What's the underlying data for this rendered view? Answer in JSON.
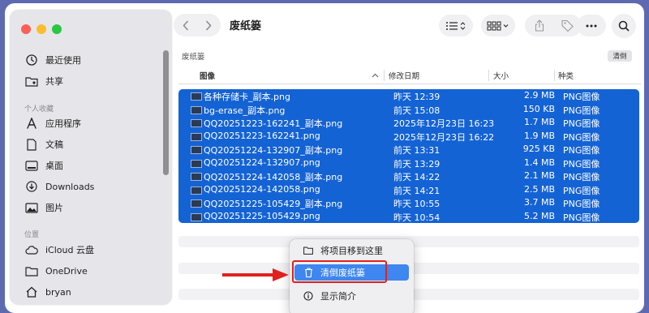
{
  "sidebar": {
    "favorites": [
      {
        "label": "最近使用",
        "icon": "clock-icon"
      },
      {
        "label": "共享",
        "icon": "shared-folder-icon"
      }
    ],
    "personal_header": "个人收藏",
    "personal": [
      {
        "label": "应用程序",
        "icon": "applications-icon"
      },
      {
        "label": "文稿",
        "icon": "document-icon"
      },
      {
        "label": "桌面",
        "icon": "desktop-icon"
      },
      {
        "label": "Downloads",
        "icon": "downloads-icon"
      },
      {
        "label": "图片",
        "icon": "pictures-icon"
      }
    ],
    "locations_header": "位置",
    "locations": [
      {
        "label": "iCloud 云盘",
        "icon": "cloud-icon"
      },
      {
        "label": "OneDrive",
        "icon": "folder-icon"
      },
      {
        "label": "bryan",
        "icon": "home-icon"
      }
    ]
  },
  "toolbar": {
    "title": "废纸篓"
  },
  "pathbar": {
    "location": "废纸篓",
    "clear_label": "清倒"
  },
  "table": {
    "columns": {
      "name": "图像",
      "date": "修改日期",
      "size": "大小",
      "kind": "种类"
    },
    "rows": [
      {
        "name": "各种存储卡_副本.png",
        "date": "昨天 12:39",
        "size": "2.9 MB",
        "kind": "PNG图像"
      },
      {
        "name": "bg-erase_副本.png",
        "date": "前天 15:08",
        "size": "150 KB",
        "kind": "PNG图像"
      },
      {
        "name": "QQ20251223-162241_副本.png",
        "date": "2025年12月23日 16:23",
        "size": "1.7 MB",
        "kind": "PNG图像"
      },
      {
        "name": "QQ20251223-162241.png",
        "date": "2025年12月23日 16:22",
        "size": "1.9 MB",
        "kind": "PNG图像"
      },
      {
        "name": "QQ20251224-132907_副本.png",
        "date": "前天 13:31",
        "size": "925 KB",
        "kind": "PNG图像"
      },
      {
        "name": "QQ20251224-132907.png",
        "date": "前天 13:29",
        "size": "1.4 MB",
        "kind": "PNG图像"
      },
      {
        "name": "QQ20251224-142058_副本.png",
        "date": "前天 14:22",
        "size": "2.1 MB",
        "kind": "PNG图像"
      },
      {
        "name": "QQ20251224-142058.png",
        "date": "前天 14:21",
        "size": "2.5 MB",
        "kind": "PNG图像"
      },
      {
        "name": "QQ20251225-105429_副本.png",
        "date": "昨天 10:55",
        "size": "3.7 MB",
        "kind": "PNG图像"
      },
      {
        "name": "QQ20251225-105429.png",
        "date": "昨天 10:54",
        "size": "5.2 MB",
        "kind": "PNG图像"
      }
    ]
  },
  "context_menu": {
    "items": [
      {
        "label": "将项目移到这里",
        "icon": "folder-icon"
      },
      {
        "label": "清倒废纸篓",
        "icon": "trash-icon",
        "highlighted": true
      },
      {
        "label": "显示简介",
        "icon": "info-icon"
      }
    ]
  },
  "colors": {
    "selection": "#1463d4",
    "menu_highlight": "#3e86f0",
    "annotation": "#e0211f"
  }
}
